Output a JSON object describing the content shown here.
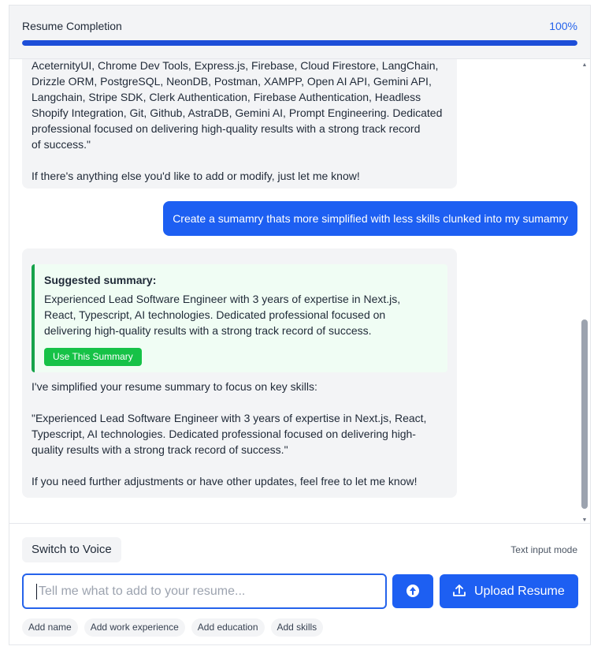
{
  "header": {
    "title": "Resume Completion",
    "percent": "100%",
    "progress": 1.0
  },
  "chat": {
    "ai_message_1": {
      "lines": [
        "AceternityUI, Chrome Dev Tools, Express.js, Firebase, Cloud Firestore, LangChain,",
        "Drizzle ORM, PostgreSQL, NeonDB, Postman, XAMPP, Open AI API, Gemini API,",
        "Langchain, Stripe SDK, Clerk Authentication, Firebase Authentication, Headless",
        "Shopify Integration, Git, Github, AstraDB, Gemini AI, Prompt Engineering. Dedicated",
        "professional focused on delivering high-quality results with a strong track record",
        "of success.\""
      ],
      "closing": "If there's anything else you'd like to add or modify, just let me know!"
    },
    "user_message": "Create a sumamry thats more simplified with less skills clunked into my sumamry",
    "ai_message_2": {
      "suggestion_title": "Suggested summary:",
      "suggestion_lines": [
        "Experienced Lead Software Engineer with 3 years of expertise in Next.js,",
        "React, Typescript, AI technologies. Dedicated professional focused on",
        "delivering high-quality results with a strong track record of success."
      ],
      "use_button": "Use This Summary",
      "intro": "I've simplified your resume summary to focus on key skills:",
      "quote_lines": [
        "\"Experienced Lead Software Engineer with 3 years of expertise in Next.js, React,",
        "Typescript, AI technologies. Dedicated professional focused on delivering high-",
        "quality results with a strong track record of success.\""
      ],
      "closing": "If you need further adjustments or have other updates, feel free to let me know!"
    }
  },
  "footer": {
    "voice_button": "Switch to Voice",
    "mode_label": "Text input mode",
    "input_placeholder": "Tell me what to add to your resume...",
    "upload_button": "Upload Resume",
    "send_icon": "arrow-up-circle-icon",
    "upload_icon": "upload-icon",
    "chips": [
      "Add name",
      "Add work experience",
      "Add education",
      "Add skills"
    ]
  },
  "colors": {
    "accent": "#1d5ff2",
    "success": "#16c247",
    "suggestion_bg": "#f0fdf4"
  }
}
